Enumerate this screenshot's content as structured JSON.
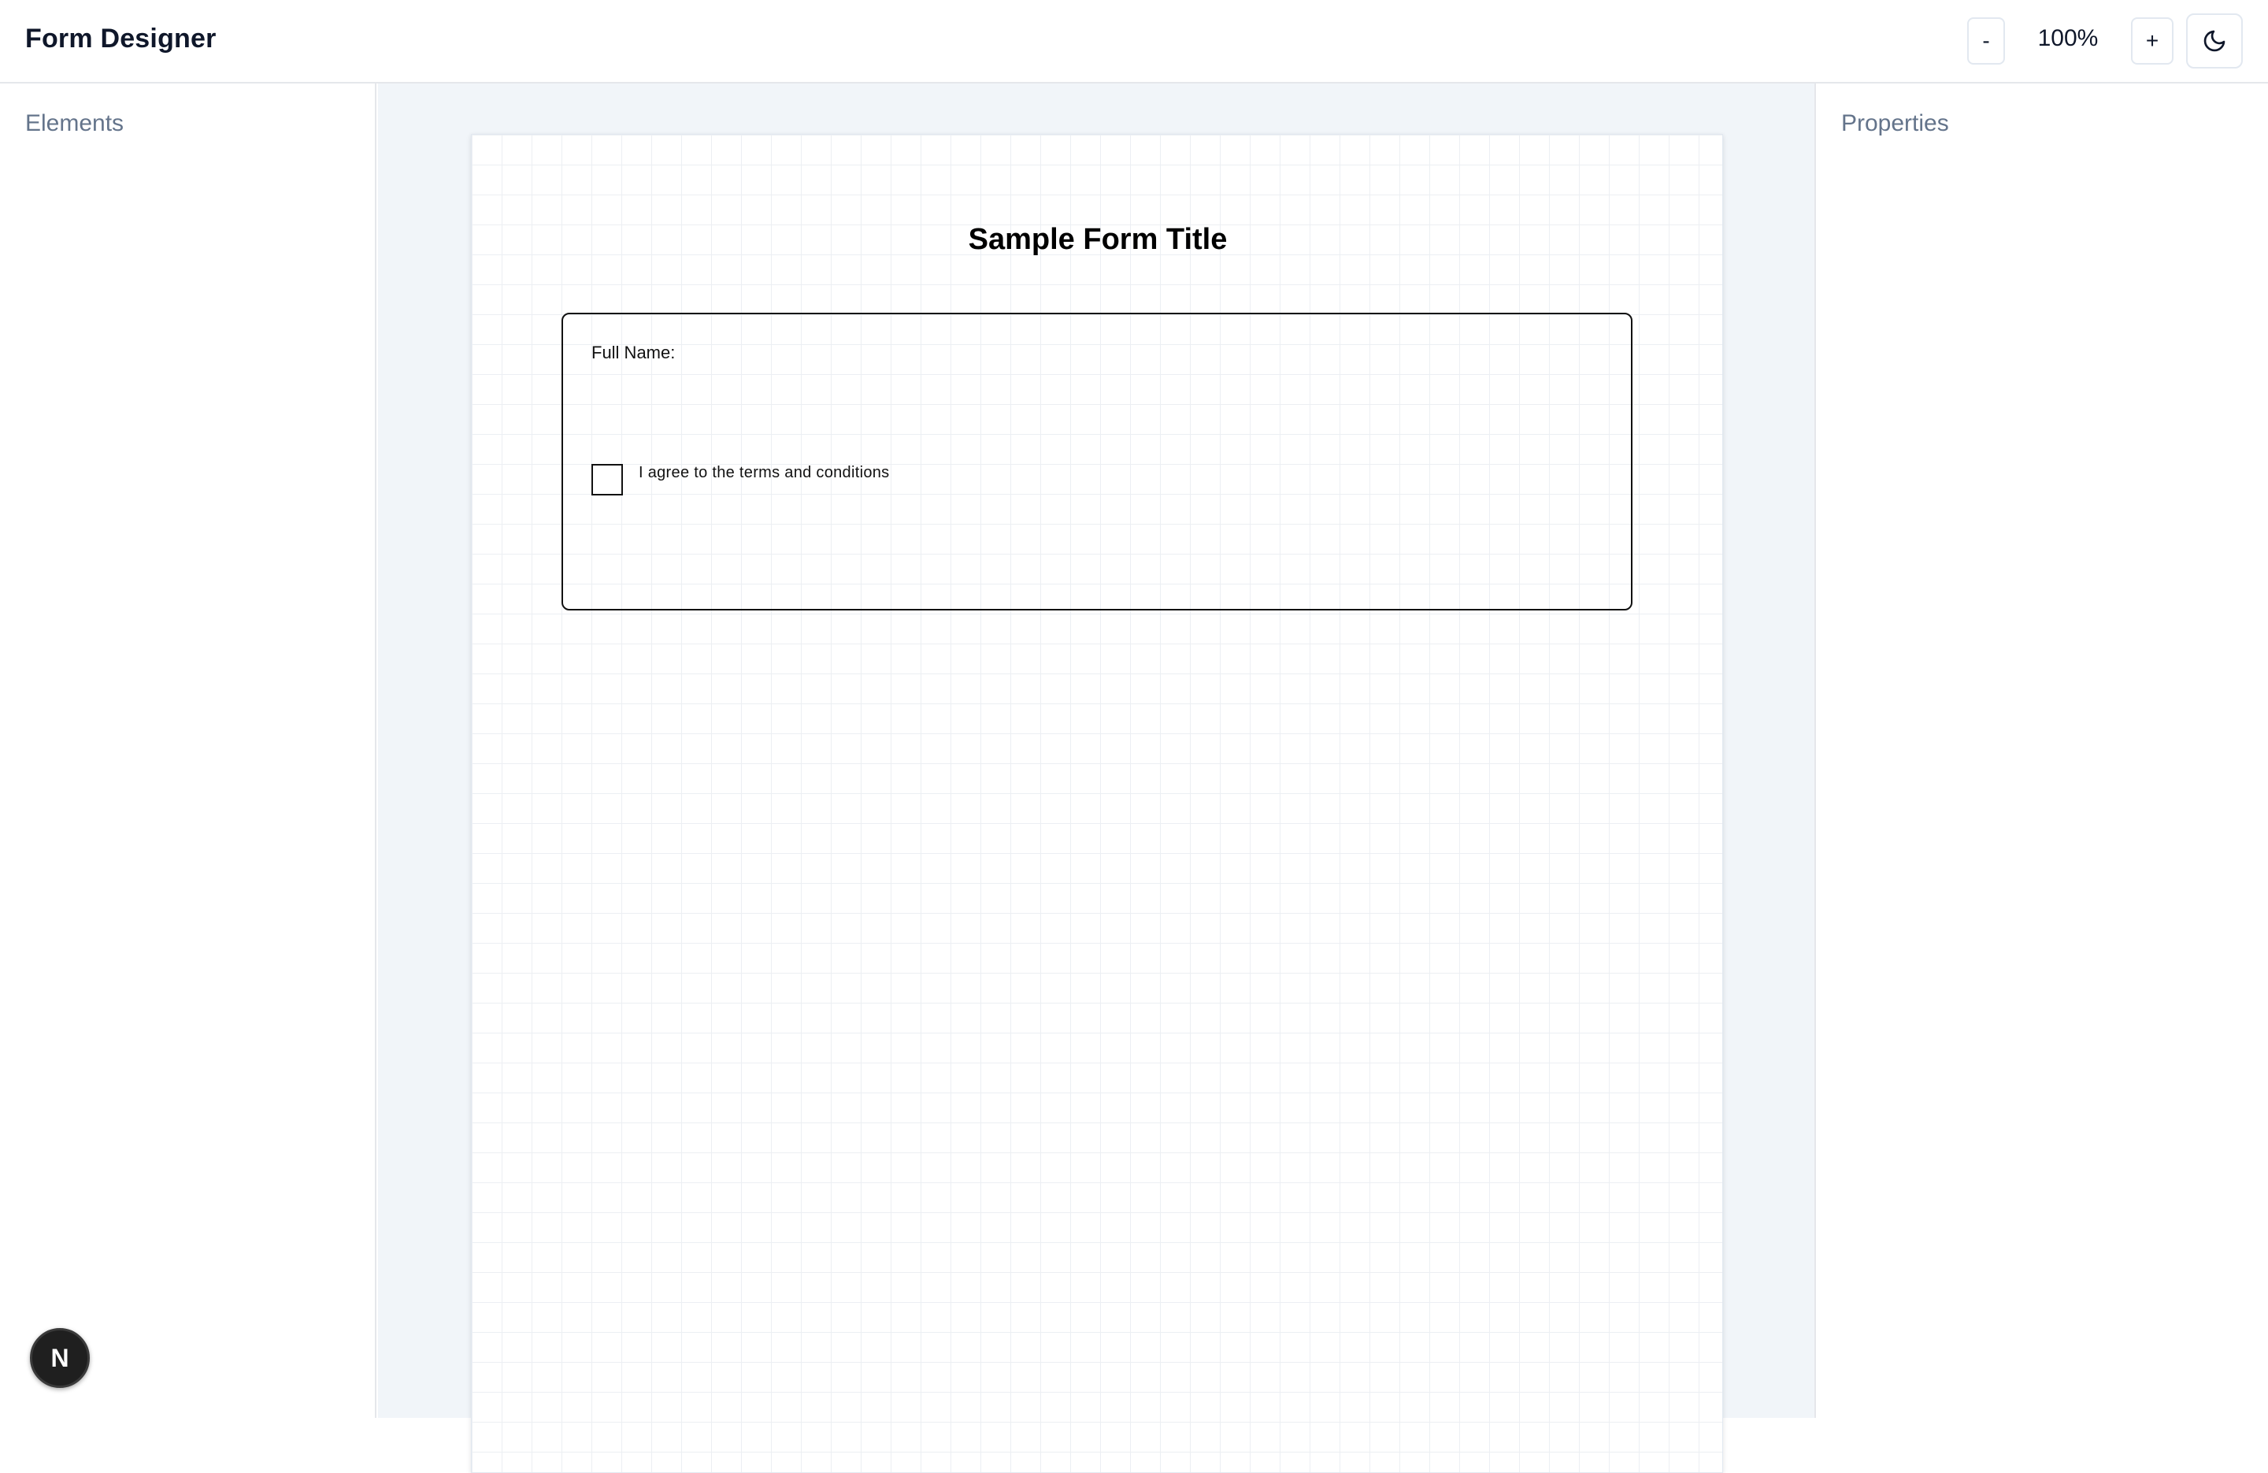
{
  "header": {
    "title": "Form Designer",
    "zoom_out_label": "-",
    "zoom_level": "100%",
    "zoom_in_label": "+",
    "theme_icon": "moon-icon"
  },
  "left_panel": {
    "title": "Elements"
  },
  "right_panel": {
    "title": "Properties"
  },
  "form": {
    "title": "Sample Form Title",
    "fields": [
      {
        "type": "text",
        "label": "Full Name:"
      },
      {
        "type": "checkbox",
        "label": "I agree to the terms and conditions",
        "checked": false
      }
    ]
  },
  "badge": {
    "letter": "N"
  },
  "colors": {
    "workspace_bg": "#f1f5f9",
    "panel_heading": "#64748b"
  }
}
